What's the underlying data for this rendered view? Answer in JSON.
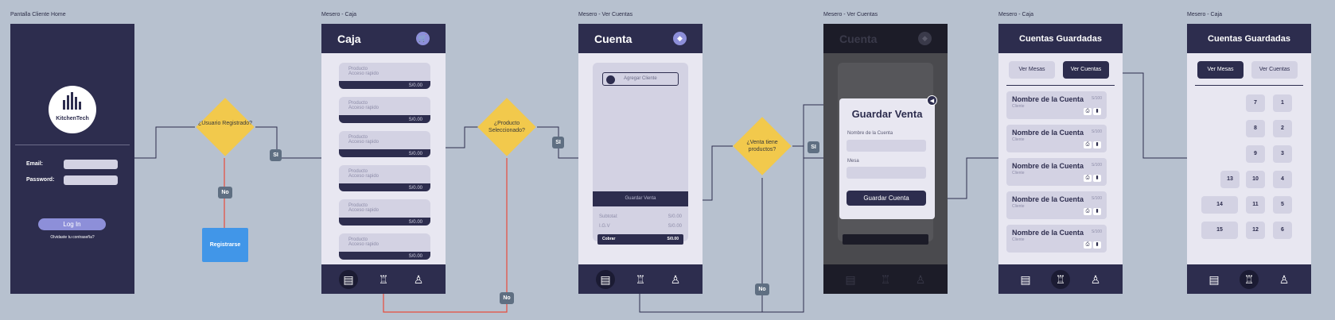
{
  "frames": {
    "f1": "Pantalla Cliente Home",
    "f2": "Mesero - Caja",
    "f3": "Mesero - Ver Cuentas",
    "f4": "Mesero - Ver Cuentas",
    "f5": "Mesero - Caja",
    "f6": "Mesero - Caja"
  },
  "home": {
    "logo_text": "KitchenTech",
    "email_label": "Email:",
    "password_label": "Password:",
    "login_button": "Log In",
    "forgot_link": "Olvidaste tu contraseña?"
  },
  "decisions": {
    "d1": "¿Usuario Registrado?",
    "d2": "¿Producto Seleccionado?",
    "d3": "¿Venta tiene productos?"
  },
  "tags": {
    "si": "SI",
    "no": "No"
  },
  "register_button": "Registrarse",
  "caja": {
    "title": "Caja",
    "card_title": "Producto",
    "card_sub": "Acceso rapido",
    "card_price": "S/0.00"
  },
  "cuenta": {
    "title": "Cuenta",
    "add_client": "Agregar Cliente",
    "save_sale": "Guardar Venta",
    "subtotal_label": "Subtotal:",
    "subtotal_value": "S/0.00",
    "igv_label": "I.G.V",
    "igv_value": "S/0.00",
    "cobrar_label": "Cobrar",
    "cobrar_value": "S/0.00"
  },
  "modal": {
    "title": "Guardar Venta",
    "account_name_label": "Nombre de la Cuenta",
    "table_label": "Mesa",
    "save_button": "Guardar Cuenta",
    "icon": "speaker-icon"
  },
  "saved": {
    "title": "Cuentas Guardadas",
    "tab_tables": "Ver Mesas",
    "tab_accounts": "Ver Cuentas",
    "account_name": "Nombre de la Cuenta",
    "account_price": "S/100",
    "account_client": "Cliente"
  },
  "tables": [
    "7",
    "1",
    "8",
    "2",
    "9",
    "3",
    "13",
    "10",
    "4",
    "14",
    "11",
    "5",
    "15",
    "12",
    "6"
  ],
  "icons": {
    "cart": "cart-icon",
    "tag": "tag-icon",
    "register": "cash-register-icon",
    "dining": "dining-table-icon",
    "chef": "chef-icon"
  },
  "colors": {
    "canvas": "#b7c1cf",
    "dark": "#2d2d4e",
    "light": "#e8e7f1",
    "yellow": "#f2c94c",
    "blue": "#4196e8",
    "red": "#e74c3c"
  }
}
